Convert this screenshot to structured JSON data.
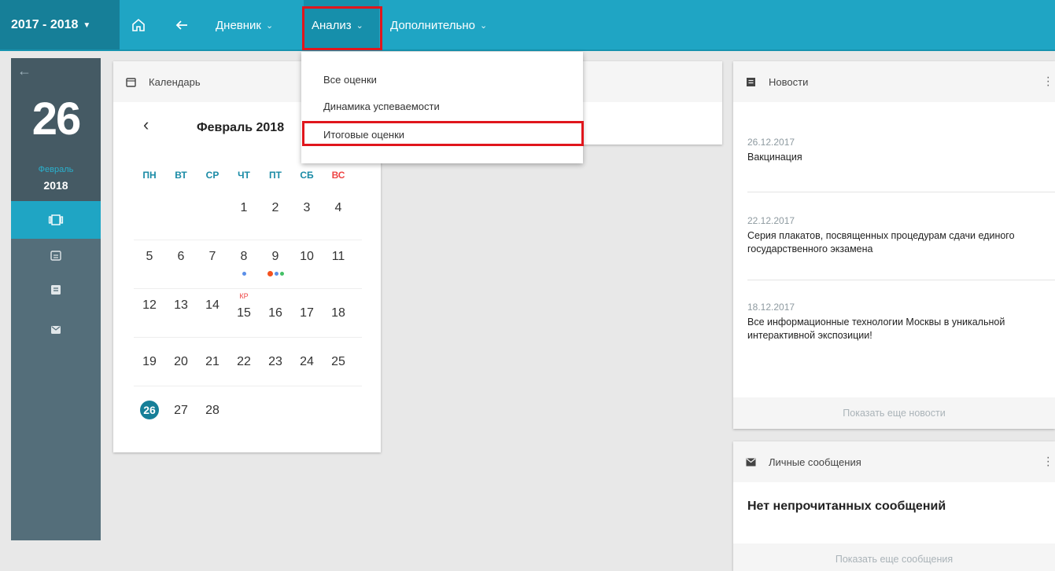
{
  "topbar": {
    "year": "2017 - 2018",
    "nav": [
      {
        "label": "Дневник"
      },
      {
        "label": "Анализ"
      },
      {
        "label": "Дополнительно"
      }
    ]
  },
  "dropdown": {
    "items": [
      "Все оценки",
      "Динамика успеваемости",
      "Итоговые оценки"
    ]
  },
  "rail": {
    "day": "26",
    "month": "Февраль",
    "year": "2018"
  },
  "calendar": {
    "header": "Календарь",
    "month_title": "Февраль 2018",
    "dow": [
      "ПН",
      "ВТ",
      "СР",
      "ЧТ",
      "ПТ",
      "СБ",
      "ВС"
    ],
    "weeks": [
      [
        "",
        "",
        "",
        "1",
        "2",
        "3",
        "4"
      ],
      [
        "5",
        "6",
        "7",
        "8",
        "9",
        "10",
        "11"
      ],
      [
        "12",
        "13",
        "14",
        "15",
        "16",
        "17",
        "18"
      ],
      [
        "19",
        "20",
        "21",
        "22",
        "23",
        "24",
        "25"
      ],
      [
        "26",
        "27",
        "28",
        "",
        "",
        "",
        ""
      ]
    ],
    "kr_label": "КР",
    "today": "26"
  },
  "news": {
    "header": "Новости",
    "entries": [
      {
        "date": "26.12.2017",
        "title": "Вакцинация"
      },
      {
        "date": "22.12.2017",
        "title": "Серия плакатов, посвященных процедурам сдачи единого государственного экзамена"
      },
      {
        "date": "18.12.2017",
        "title": "Все информационные технологии Москвы в уникальной интерактивной экспозиции!"
      }
    ],
    "more": "Показать еще новости"
  },
  "messages": {
    "header": "Личные сообщения",
    "empty": "Нет непрочитанных сообщений",
    "more": "Показать еще сообщения"
  },
  "colors": {
    "topbar": "#1fa5c4",
    "year_bg": "#167f98",
    "rail": "#546e7a",
    "highlight": "#e0161c"
  }
}
